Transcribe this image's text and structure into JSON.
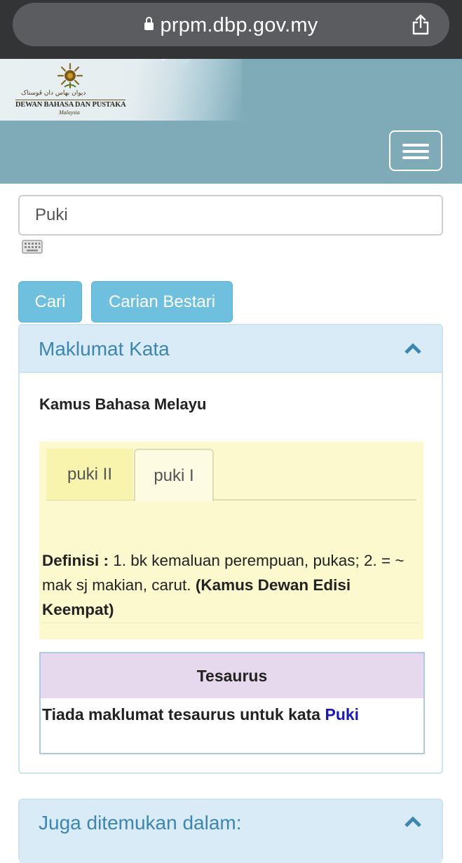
{
  "browser": {
    "url": "prpm.dbp.gov.my"
  },
  "header": {
    "logo_text": "DEWAN BAHASA DAN PUSTAKA",
    "logo_sub": "Malaysia",
    "logo_jawi": "ديوان بهاس دان ڤوستاک"
  },
  "search": {
    "value": "Puki",
    "button_cari": "Cari",
    "button_bestari": "Carian Bestari"
  },
  "panel_maklumat": {
    "title": "Maklumat Kata",
    "dictionary_title": "Kamus Bahasa Melayu",
    "tabs": [
      {
        "label": "puki II",
        "active": false
      },
      {
        "label": "puki I",
        "active": true
      }
    ],
    "definition_label": "Definisi :",
    "definition_text": " 1. bk kemaluan perempuan, pukas; 2. = ~ mak sj makian, carut. ",
    "definition_source": "(Kamus Dewan Edisi Keempat)"
  },
  "tesaurus": {
    "title": "Tesaurus",
    "message": "Tiada maklumat tesaurus untuk kata ",
    "word": "Puki"
  },
  "panel_juga": {
    "title": "Juga ditemukan dalam:"
  },
  "colors": {
    "browser_bar": "#323436",
    "header_bg": "#7fabb8",
    "button_bg": "#6fbfde",
    "panel_heading_bg": "#d9ebf6",
    "panel_title": "#3c86b0",
    "definition_bg": "#fcf9cf",
    "tesaurus_head_bg": "#e6d9ee",
    "link": "#1a1ab3"
  }
}
